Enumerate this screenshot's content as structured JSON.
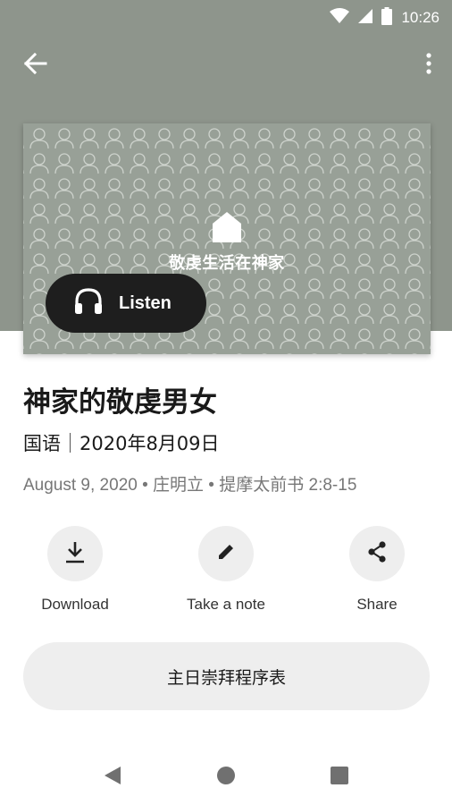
{
  "status_bar": {
    "time": "10:26"
  },
  "artwork": {
    "title": "敬虔生活在神家"
  },
  "player": {
    "listen_label": "Listen"
  },
  "sermon": {
    "title": "神家的敬虔男女",
    "language": "国语",
    "date_cn": "2020年8月09日",
    "details": "August 9, 2020 • 庄明立 • 提摩太前书 2:8-15"
  },
  "actions": [
    {
      "label": "Download",
      "icon": "download-icon"
    },
    {
      "label": "Take a note",
      "icon": "pencil-icon"
    },
    {
      "label": "Share",
      "icon": "share-icon"
    }
  ],
  "schedule_button": {
    "label": "主日崇拜程序表"
  },
  "colors": {
    "header_bg": "#8e958c",
    "artwork_bg": "#98a097",
    "listen_bg": "#1e1e1e",
    "button_bg": "#eeeeee"
  }
}
